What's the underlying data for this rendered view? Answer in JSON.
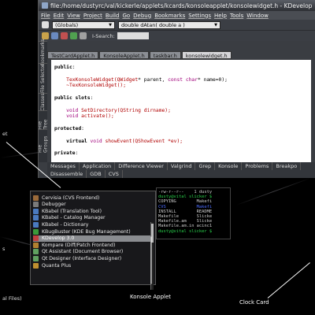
{
  "window": {
    "title": "file:/home/dustyrc/val/kickerle/applets/kcards/konsoleapplet/konsolewidget.h - KDevelop",
    "menus": [
      "File",
      "Edit",
      "View",
      "Project",
      "Build",
      "Go",
      "Debug",
      "Bookmarks",
      "Settings",
      "Help",
      "Tools",
      "Window"
    ],
    "scope_combo": "(Globals)",
    "function_combo": "double dAtan( double a )",
    "search_label": "I-Search:",
    "vertical_tabs": [
      "Bookmarks",
      "File Selector",
      "Classes",
      "File Tree",
      "File Groups"
    ],
    "editor_tabs": [
      "TestCardApplet.h",
      "KonsoleApplet.h",
      "taskbar.h",
      "konsolewidget.h"
    ],
    "active_editor_tab": 3,
    "code_lines": [
      {
        "parts": [
          {
            "t": "public",
            "c": "kw"
          },
          {
            "t": ":",
            "c": ""
          }
        ]
      },
      {
        "parts": [
          {
            "t": "",
            "c": ""
          }
        ]
      },
      {
        "parts": [
          {
            "t": "    TexKonsoleWidget(",
            "c": "fn"
          },
          {
            "t": "QWidget",
            "c": "fn"
          },
          {
            "t": "* parent, ",
            "c": ""
          },
          {
            "t": "const char",
            "c": "ty"
          },
          {
            "t": "* name=0);",
            "c": ""
          }
        ]
      },
      {
        "parts": [
          {
            "t": "    ~TexKonsoleWidget();",
            "c": "fn"
          }
        ]
      },
      {
        "parts": [
          {
            "t": "",
            "c": ""
          }
        ]
      },
      {
        "parts": [
          {
            "t": "public slots",
            "c": "kw"
          },
          {
            "t": ":",
            "c": ""
          }
        ]
      },
      {
        "parts": [
          {
            "t": "",
            "c": ""
          }
        ]
      },
      {
        "parts": [
          {
            "t": "    void ",
            "c": "ty"
          },
          {
            "t": "SetDirectory(",
            "c": "fn"
          },
          {
            "t": "QString dirname);",
            "c": "fn"
          }
        ]
      },
      {
        "parts": [
          {
            "t": "    void ",
            "c": "ty"
          },
          {
            "t": "activate();",
            "c": "fn"
          }
        ]
      },
      {
        "parts": [
          {
            "t": "",
            "c": ""
          }
        ]
      },
      {
        "parts": [
          {
            "t": "protected",
            "c": "kw"
          },
          {
            "t": ":",
            "c": ""
          }
        ]
      },
      {
        "parts": [
          {
            "t": "",
            "c": ""
          }
        ]
      },
      {
        "parts": [
          {
            "t": "    virtual ",
            "c": "kw"
          },
          {
            "t": "void ",
            "c": "ty"
          },
          {
            "t": "showEvent(",
            "c": "fn"
          },
          {
            "t": "QShowEvent *ev);",
            "c": "fn"
          }
        ]
      },
      {
        "parts": [
          {
            "t": "",
            "c": ""
          }
        ]
      },
      {
        "parts": [
          {
            "t": "private",
            "c": "kw"
          },
          {
            "t": ":",
            "c": ""
          }
        ]
      }
    ],
    "bottom_tabs_row1": [
      "Messages",
      "Application",
      "Difference Viewer",
      "Valgrind",
      "Grep",
      "Konsole",
      "Problems",
      "Breakpo"
    ],
    "bottom_tabs_row2": [
      "Disassemble",
      "GDB",
      "CVS"
    ]
  },
  "konsole": {
    "lines": [
      {
        "t": "-rw-r--r--    1 dusty",
        "c": ""
      },
      {
        "t": "dusty@vital slicker $",
        "c": "k-green"
      },
      {
        "t": "COPYING        Makefi",
        "c": ""
      },
      {
        "t": "CVS            Makefi",
        "c": "k-blue"
      },
      {
        "t": "INSTALL        README",
        "c": ""
      },
      {
        "t": "Makefile       Slicke",
        "c": ""
      },
      {
        "t": "Makefile.am    Slicke",
        "c": ""
      },
      {
        "t": "Makefile.am.in acinc1",
        "c": ""
      },
      {
        "t": "dusty@vital slicker $",
        "c": "k-green"
      }
    ]
  },
  "kmenu": {
    "items": [
      {
        "label": "Cervisia (CVS Frontend)",
        "icon_color": "#9a6a3a"
      },
      {
        "label": "Debugger",
        "icon_color": "#7a7a7a"
      },
      {
        "label": "KBabel (Translation Tool)",
        "icon_color": "#4a7ac0"
      },
      {
        "label": "KBabel - Catalog Manager",
        "icon_color": "#4a7ac0"
      },
      {
        "label": "KBabel - Dictionary",
        "icon_color": "#4a7ac0"
      },
      {
        "label": "KBugBuster (KDE Bug Management)",
        "icon_color": "#3a9a3a"
      },
      {
        "label": "KDevelop 3.0",
        "icon_color": "#c04040"
      },
      {
        "label": "Kompare (Diff/Patch Frontend)",
        "icon_color": "#b08030"
      },
      {
        "label": "Qt Assistant (Document Browser)",
        "icon_color": "#60a060"
      },
      {
        "label": "Qt Designer (Interface Designer)",
        "icon_color": "#60a060"
      },
      {
        "label": "Quanta Plus",
        "icon_color": "#c09030"
      }
    ],
    "selected_index": 6
  },
  "left_fragments": {
    "frag1": "et",
    "frag2": "s",
    "frag3": "al Files)"
  },
  "callouts": {
    "konsole_applet": "Konsole Applet",
    "clock_card": "Clock Card"
  }
}
